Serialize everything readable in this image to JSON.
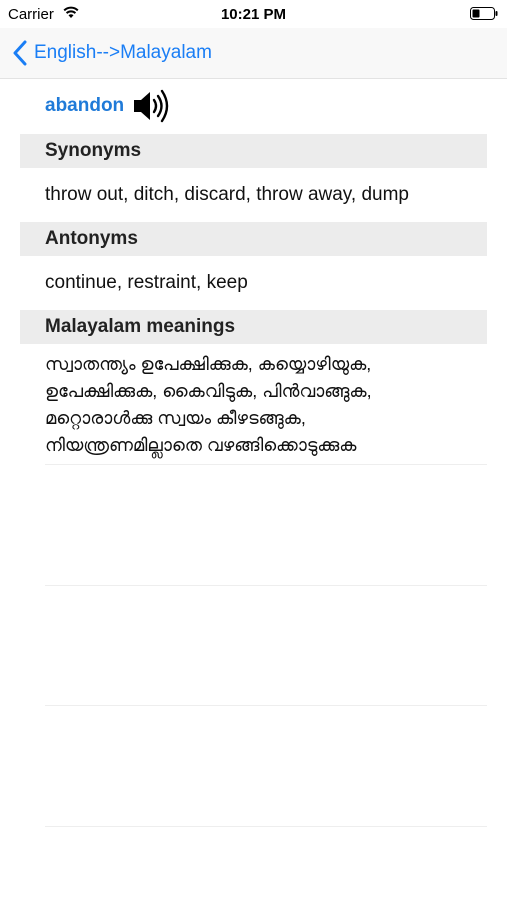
{
  "status_bar": {
    "carrier": "Carrier",
    "time": "10:21 PM"
  },
  "nav": {
    "back_label": "English-->Malayalam"
  },
  "entry": {
    "word": "abandon",
    "synonyms_title": "Synonyms",
    "synonyms": "throw out, ditch, discard, throw away, dump",
    "antonyms_title": "Antonyms",
    "antonyms": "continue, restraint, keep",
    "meanings_title": "Malayalam meanings",
    "meanings": [
      "സ്വാതന്ത്യം ഉപേക്ഷിക്കുക, കയ്യൊഴിയുക,",
      "ഉപേക്ഷിക്കുക, കൈവിടുക, പിൻവാങ്ങുക,",
      "മറ്റൊരാൾക്കു സ്വയം കീഴടങ്ങുക,",
      "നിയന്ത്രണമില്ലാതെ വഴങ്ങിക്കൊടുക്കുക"
    ]
  },
  "colors": {
    "accent": "#1a7ef5",
    "word": "#1f7ad8",
    "section_bg": "#ececec"
  }
}
